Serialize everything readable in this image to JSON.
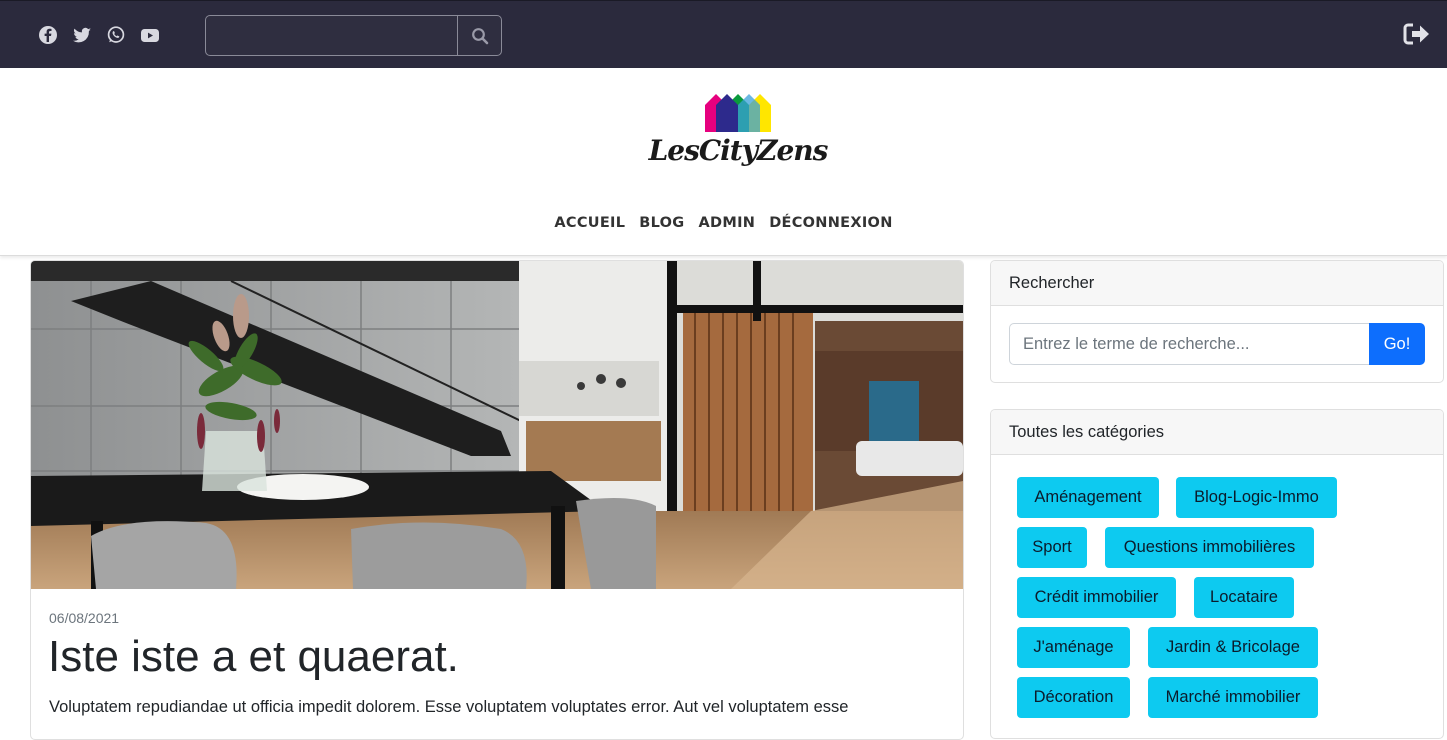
{
  "topbar": {
    "social_icons": [
      "facebook-icon",
      "twitter-icon",
      "whatsapp-icon",
      "youtube-icon"
    ],
    "search": {
      "value": "",
      "placeholder": ""
    },
    "search_button_icon": "search-icon",
    "logout_icon": "sign-out-icon"
  },
  "header": {
    "logo_text": "LesCityZens",
    "nav": [
      "ACCUEIL",
      "BLOG",
      "ADMIN",
      "DÉCONNEXION"
    ]
  },
  "post": {
    "date": "06/08/2021",
    "title": "Iste iste a et quaerat.",
    "excerpt": "Voluptatem repudiandae ut officia impedit dolorem. Esse voluptatem voluptates error. Aut vel voluptatem esse"
  },
  "sidebar": {
    "search": {
      "heading": "Rechercher",
      "placeholder": "Entrez le terme de recherche...",
      "button": "Go!"
    },
    "categories": {
      "heading": "Toutes les catégories",
      "items": [
        "Aménagement",
        "Blog-Logic-Immo",
        "Sport",
        "Questions immobilières",
        "Crédit immobilier",
        "Locataire",
        "J'aménage",
        "Jardin & Bricolage",
        "Décoration",
        "Marché immobilier"
      ]
    }
  },
  "colors": {
    "topbar_bg": "#2b2a3d",
    "go_button": "#0d6efd",
    "category_button": "#0dcaf0",
    "logo_magenta": "#e6007e",
    "logo_blue": "#2d2a8c",
    "logo_green": "#0a9a3c",
    "logo_yellow": "#ffe600"
  }
}
